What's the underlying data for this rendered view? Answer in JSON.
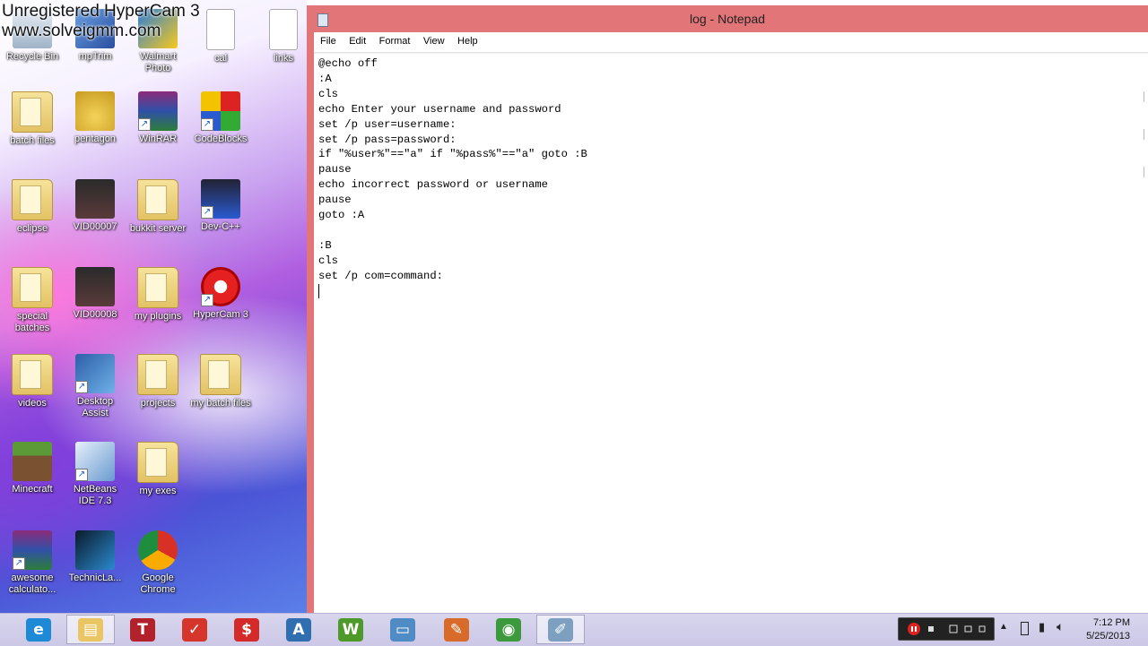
{
  "watermark": {
    "line1": "Unregistered HyperCam 3",
    "line2": "www.solveigmm.com"
  },
  "desktop": {
    "icons": [
      {
        "label": "Recycle Bin",
        "icon": "recycle-bin-icon"
      },
      {
        "label": "mpTrim",
        "icon": "mptrim-icon"
      },
      {
        "label": "Walmart Photo",
        "icon": "walmart-photo-icon"
      },
      {
        "label": "cal",
        "icon": "text-file-icon"
      },
      {
        "label": "links",
        "icon": "text-file-icon"
      },
      {
        "label": "batch files",
        "icon": "folder-icon"
      },
      {
        "label": "pentagon",
        "icon": "lock-icon"
      },
      {
        "label": "WinRAR",
        "icon": "winrar-icon"
      },
      {
        "label": "CodeBlocks",
        "icon": "codeblocks-icon"
      },
      {
        "label": "eclipse",
        "icon": "folder-icon"
      },
      {
        "label": "VID00007",
        "icon": "video-thumbnail-icon"
      },
      {
        "label": "bukkit server",
        "icon": "folder-icon"
      },
      {
        "label": "Dev-C++",
        "icon": "devcpp-icon"
      },
      {
        "label": "special batches",
        "icon": "folder-icon"
      },
      {
        "label": "VID00008",
        "icon": "video-thumbnail-icon"
      },
      {
        "label": "my plugins",
        "icon": "folder-icon"
      },
      {
        "label": "HyperCam 3",
        "icon": "hypercam-icon"
      },
      {
        "label": "videos",
        "icon": "folder-icon"
      },
      {
        "label": "Desktop Assist",
        "icon": "desktop-assist-icon"
      },
      {
        "label": "projects",
        "icon": "folder-icon"
      },
      {
        "label": "my batch files",
        "icon": "folder-icon"
      },
      {
        "label": "Minecraft",
        "icon": "minecraft-icon"
      },
      {
        "label": "NetBeans IDE 7.3",
        "icon": "netbeans-icon"
      },
      {
        "label": "my exes",
        "icon": "folder-icon"
      },
      {
        "label": "awesome calculato...",
        "icon": "winrar-icon"
      },
      {
        "label": "TechnicLa...",
        "icon": "technic-launcher-icon"
      },
      {
        "label": "Google Chrome",
        "icon": "chrome-icon"
      }
    ]
  },
  "notepad": {
    "title": "log - Notepad",
    "menu": [
      "File",
      "Edit",
      "Format",
      "View",
      "Help"
    ],
    "content": "@echo off\n:A\ncls\necho Enter your username and password\nset /p user=username:\nset /p pass=password:\nif \"%user%\"==\"a\" if \"%pass%\"==\"a\" goto :B\npause\necho incorrect password or username\npause\ngoto :A\n\n:B\ncls\nset /p com=command:\n"
  },
  "taskbar": {
    "buttons": [
      {
        "name": "internet-explorer-icon",
        "glyph": "e",
        "color": "#1e8ad6"
      },
      {
        "name": "file-explorer-icon",
        "glyph": "▤",
        "color": "#e9c663",
        "active": true
      },
      {
        "name": "textpad-icon",
        "glyph": "T",
        "color": "#b3212a"
      },
      {
        "name": "todo-app-icon",
        "glyph": "✓",
        "color": "#d6352b"
      },
      {
        "name": "dollar-app-icon",
        "glyph": "$",
        "color": "#d42a2a"
      },
      {
        "name": "font-app-icon",
        "glyph": "A",
        "color": "#2f6fb0"
      },
      {
        "name": "wordpad-icon",
        "glyph": "W",
        "color": "#4d9a2a"
      },
      {
        "name": "display-app-icon",
        "glyph": "▭",
        "color": "#4f8bc4"
      },
      {
        "name": "paint-app-icon",
        "glyph": "✎",
        "color": "#d86a2a"
      },
      {
        "name": "chrome-icon",
        "glyph": "◉",
        "color": "#3c9a3c"
      },
      {
        "name": "notepad-icon",
        "glyph": "✐",
        "color": "#7ea0c0",
        "active": true
      }
    ],
    "clock": {
      "time": "7:12 PM",
      "date": "5/25/2013"
    }
  }
}
